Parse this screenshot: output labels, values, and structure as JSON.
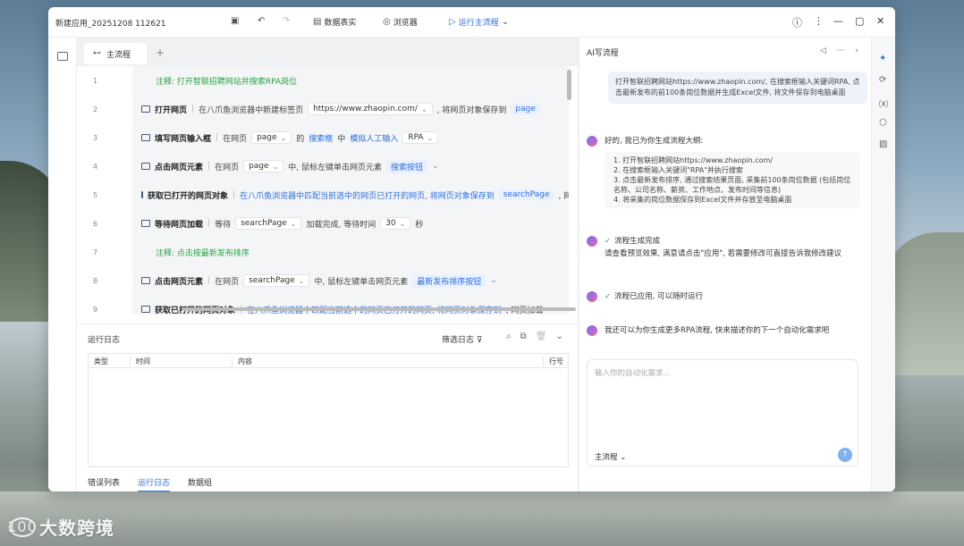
{
  "window": {
    "title": "新建应用_20251208 112621",
    "toolbar": {
      "save_label": "",
      "data_table_label": "数据表实",
      "browser_label": "浏览器",
      "run_label": "运行主流程"
    }
  },
  "editor": {
    "tab_label": "主流程",
    "lines": [
      {
        "num": "1",
        "comment": "注释: 打开智联招聘网站并搜索RPA岗位"
      },
      {
        "num": "2",
        "cmd": "打开网页",
        "text1": "在八爪鱼浏览器中新建标签页",
        "chip": "https://www.zhaopin.com/",
        "text2": ", 将网页对象保存到",
        "var": "page"
      },
      {
        "num": "3",
        "cmd": "填写网页输入框",
        "text1": "在网页",
        "chip": "page",
        "text2": "的",
        "hl": "搜索框",
        "text3": "中",
        "hl2": "模拟人工输入",
        "chip2": "RPA"
      },
      {
        "num": "4",
        "cmd": "点击网页元素",
        "text1": "在网页",
        "chip": "page",
        "text2": "中, 鼠标左键单击网页元素",
        "var": "搜索按钮"
      },
      {
        "num": "5",
        "cmd": "获取已打开的网页对象",
        "text1": "在八爪鱼浏览器中匹配当前选中的网页已打开的网页, 将网页对象保存到",
        "var": "searchPage",
        "text2": ", 网页加载"
      },
      {
        "num": "6",
        "cmd": "等待网页加载",
        "text1": "等待",
        "chip": "searchPage",
        "text2": "加载完成, 等待时间",
        "chip2": "30",
        "text3": "秒"
      },
      {
        "num": "7",
        "comment": "注释: 点击按最新发布排序"
      },
      {
        "num": "8",
        "cmd": "点击网页元素",
        "text1": "在网页",
        "chip": "searchPage",
        "text2": "中, 鼠标左键单击网页元素",
        "var": "最新发布排序按钮"
      },
      {
        "num": "9",
        "cmd": "获取已打开的网页对象",
        "text1": "在八爪鱼浏览器中匹配当前选中的网页已打开的网页, 将网页对象保存到",
        "var": "",
        "text2": ", 网页加载"
      }
    ]
  },
  "log": {
    "title": "运行日志",
    "filter": "筛选日志",
    "columns": [
      "类型",
      "时间",
      "内容",
      "行号"
    ],
    "tabs": [
      "错误列表",
      "运行日志",
      "数据组"
    ]
  },
  "ai": {
    "title": "AI写流程",
    "user_message": "打开智联招聘网站https://www.zhaopin.com/, 在搜索框输入关键词RPA, 点击最新发布的前100条岗位数据并生成Excel文件, 将文件保存到电脑桌面",
    "reply_intro": "好的, 我已为你生成流程大纲:",
    "outline": [
      "1. 打开智联招聘网站https://www.zhaopin.com/",
      "2. 在搜索框输入关键词\"RPA\"并执行搜索",
      "3. 点击最新发布排序, 通过搜索结果页面, 采集前100条岗位数据 (包括岗位名称、公司名称、薪资、工作地点、发布时间等信息)",
      "4. 将采集的岗位数据保存到Excel文件并存放至电脑桌面"
    ],
    "status1_title": "流程生成完成",
    "status1_text": "请查看预览效果, 满意请点击\"应用\", 若需要修改可直接告诉我修改建议",
    "status2_text": "流程已应用, 可以随时运行",
    "followup": "我还可以为你生成更多RPA流程, 快来描述你的下一个自动化需求吧",
    "input_placeholder": "输入你的自动化需求...",
    "mode_label": "主流程"
  },
  "watermark": "大数跨境"
}
